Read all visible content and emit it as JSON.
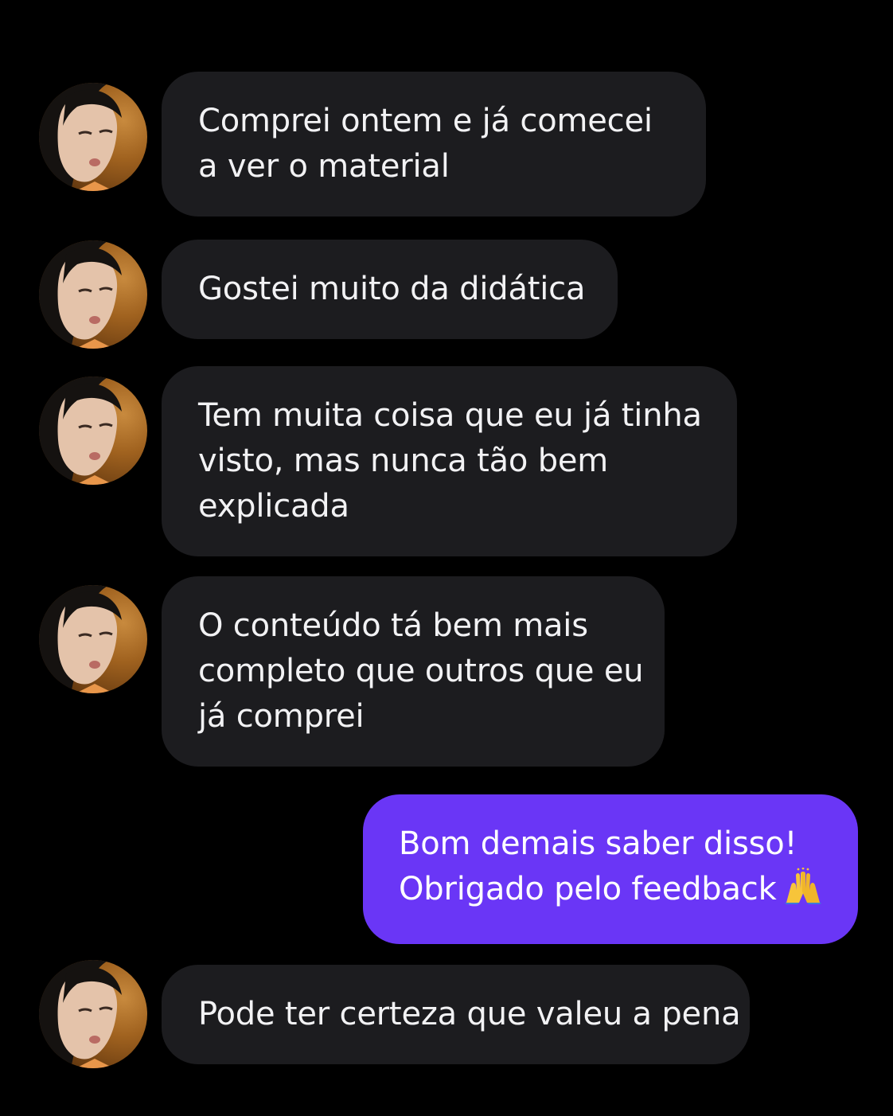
{
  "conversation": {
    "messages": [
      {
        "sender": "contact",
        "lines": [
          "Comprei ontem e já comecei",
          "a ver o material"
        ]
      },
      {
        "sender": "contact",
        "lines": [
          "Gostei muito da didática"
        ]
      },
      {
        "sender": "contact",
        "lines": [
          "Tem muita coisa que eu já tinha",
          "visto, mas nunca tão bem",
          "explicada"
        ]
      },
      {
        "sender": "contact",
        "lines": [
          "O conteúdo tá bem mais",
          "completo que outros que eu",
          "já comprei"
        ]
      },
      {
        "sender": "me",
        "lines": [
          "Bom demais saber disso!",
          "Obrigado pelo feedback"
        ],
        "emoji": "raising-hands-icon"
      },
      {
        "sender": "contact",
        "lines": [
          "Pode ter certeza que valeu a pena"
        ]
      }
    ]
  },
  "colors": {
    "background": "#000000",
    "incoming_bubble": "#1c1c1f",
    "outgoing_bubble": "#6a36f6",
    "text": "#f2f2f4",
    "avatar_backdrop": "#a0621f"
  }
}
